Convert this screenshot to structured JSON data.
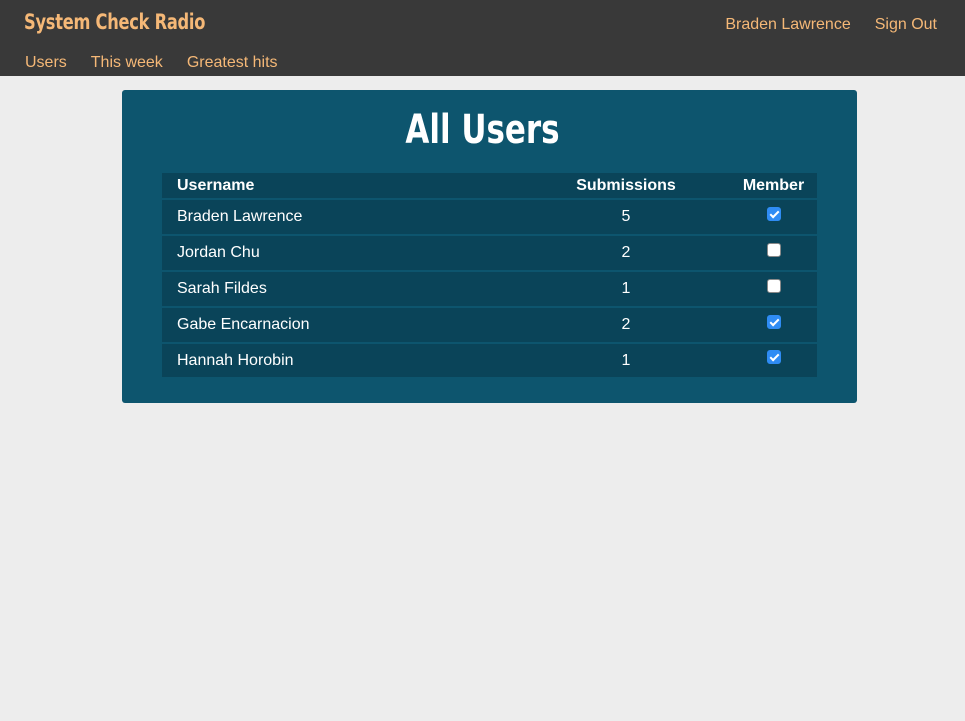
{
  "header": {
    "brand": "System Check Radio",
    "user_name": "Braden Lawrence",
    "sign_out": "Sign Out",
    "nav": [
      {
        "label": "Users"
      },
      {
        "label": "This week"
      },
      {
        "label": "Greatest hits"
      }
    ]
  },
  "main": {
    "title": "All Users",
    "table": {
      "columns": [
        "Username",
        "Submissions",
        "Member"
      ],
      "rows": [
        {
          "username": "Braden Lawrence",
          "submissions": "5",
          "member": true
        },
        {
          "username": "Jordan Chu",
          "submissions": "2",
          "member": false
        },
        {
          "username": "Sarah Fildes",
          "submissions": "1",
          "member": false
        },
        {
          "username": "Gabe Encarnacion",
          "submissions": "2",
          "member": true
        },
        {
          "username": "Hannah Horobin",
          "submissions": "1",
          "member": true
        }
      ]
    }
  },
  "colors": {
    "topbar": "#393939",
    "accent": "#f5b877",
    "panel": "#0d556e",
    "table_row": "#0a4459",
    "checkbox_on": "#2f8cf4",
    "page_bg": "#ededed"
  }
}
